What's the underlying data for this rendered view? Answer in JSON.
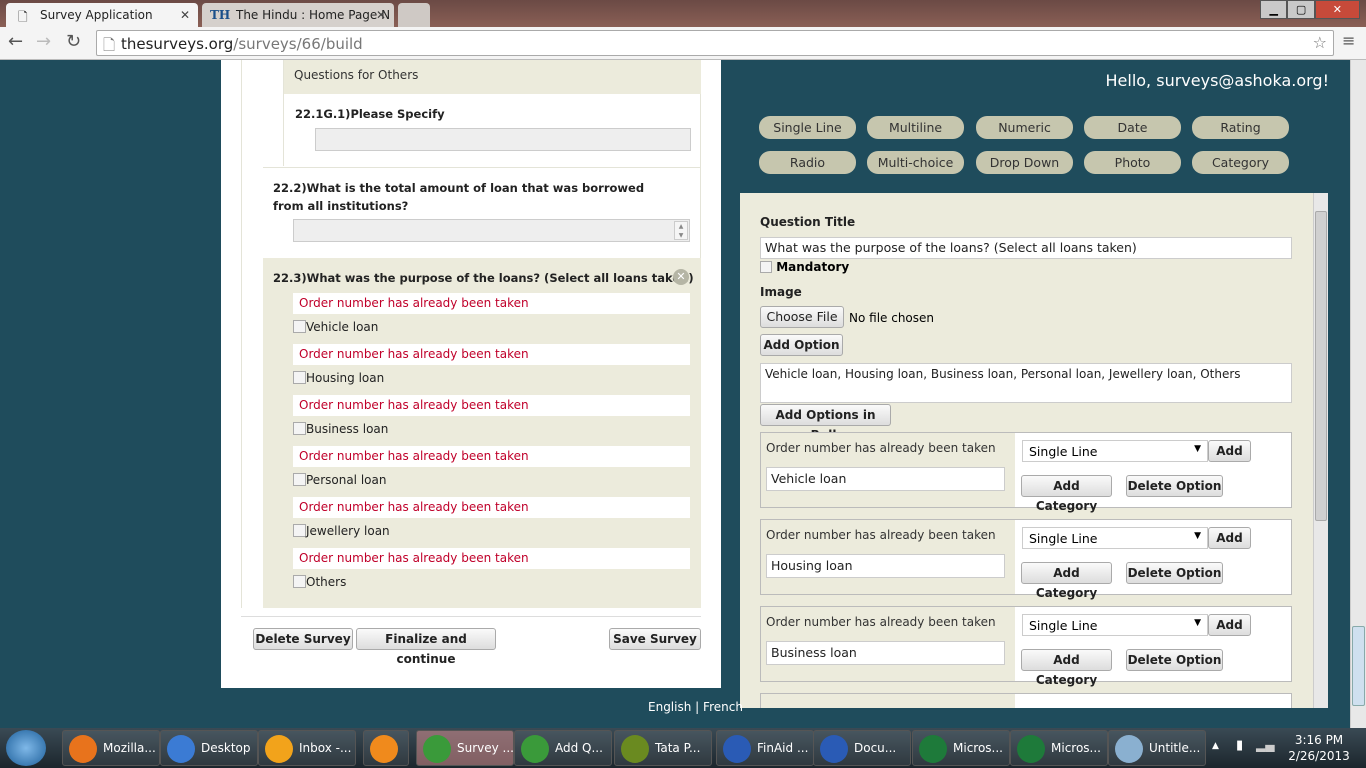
{
  "browser": {
    "tabs": [
      {
        "title": "Survey Application",
        "icon": "page-icon"
      },
      {
        "title": "The Hindu : Home Page N",
        "icon": "th-icon"
      }
    ],
    "url_host": "thesurveys.org",
    "url_path": "/surveys/66/build"
  },
  "header": {
    "greeting": "Hello, surveys@ashoka.org!"
  },
  "left": {
    "group_label": "Questions for Others",
    "q_specify": "22.1G.1)Please Specify",
    "q_total": "22.2)What is the total amount of loan that was borrowed from all institutions?",
    "q_purpose": "22.3)What was the purpose of the loans? (Select all loans taken)",
    "error": "Order number has already been taken",
    "options": [
      "Vehicle loan",
      "Housing loan",
      "Business loan",
      "Personal loan",
      "Jewellery loan",
      "Others"
    ],
    "buttons": {
      "delete": "Delete Survey",
      "finalize": "Finalize and continue",
      "save": "Save Survey"
    }
  },
  "types": [
    "Single Line",
    "Multiline",
    "Numeric",
    "Date",
    "Rating",
    "Radio",
    "Multi-choice",
    "Drop Down",
    "Photo",
    "Category"
  ],
  "editor": {
    "title_label": "Question Title",
    "title_value": "What was the purpose of the loans? (Select all loans taken)",
    "mandatory": "Mandatory",
    "image_label": "Image",
    "choose_file": "Choose File",
    "no_file": "No file chosen",
    "add_option": "Add Option",
    "bulk_value": "Vehicle loan, Housing loan, Business loan, Personal loan, Jewellery loan, Others",
    "add_bulk": "Add Options in Bulk",
    "cards": [
      {
        "error": "Order number has already been taken",
        "value": "Vehicle loan",
        "type": "Single Line"
      },
      {
        "error": "Order number has already been taken",
        "value": "Housing loan",
        "type": "Single Line"
      },
      {
        "error": "Order number has already been taken",
        "value": "Business loan",
        "type": "Single Line"
      }
    ],
    "add": "Add",
    "add_category": "Add Category",
    "delete_option": "Delete Option"
  },
  "footer": {
    "english": "English",
    "sep": "|",
    "french": "French"
  },
  "taskbar": {
    "items": [
      {
        "label": "Mozilla...",
        "color": "#e8731c"
      },
      {
        "label": "Desktop",
        "color": "#3b7bd4"
      },
      {
        "label": "Inbox -...",
        "color": "#f2a31b"
      },
      {
        "label": "",
        "color": "#f08a1c"
      },
      {
        "label": "Survey ...",
        "color": "#3a9a3a",
        "active": true
      },
      {
        "label": "Add Q...",
        "color": "#3a9a3a"
      },
      {
        "label": "Tata P...",
        "color": "#6a8a20"
      },
      {
        "label": "FinAid ...",
        "color": "#2a5bb5"
      },
      {
        "label": "Docu...",
        "color": "#2a5bb5"
      },
      {
        "label": "Micros...",
        "color": "#1e7a3a"
      },
      {
        "label": "Micros...",
        "color": "#1e7a3a"
      },
      {
        "label": "Untitle...",
        "color": "#8ab0d0"
      }
    ],
    "time": "3:16 PM",
    "date": "2/26/2013"
  }
}
